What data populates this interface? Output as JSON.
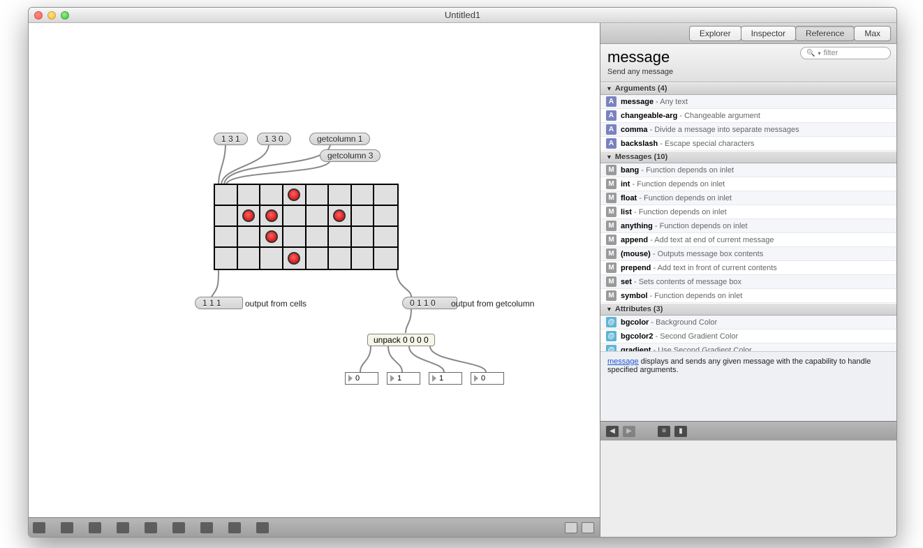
{
  "window": {
    "title": "Untitled1"
  },
  "patcher": {
    "messages": {
      "m131": "1 3 1",
      "m130": "1 3 0",
      "gc1": "getcolumn 1",
      "gc3": "getcolumn 3",
      "out_cells": "1 1 1",
      "out_col": "0 1 1 0"
    },
    "comments": {
      "cells": "output from cells",
      "col": "output from getcolumn"
    },
    "objects": {
      "unpack": "unpack 0 0 0 0"
    },
    "numbers": {
      "n1": "0",
      "n2": "1",
      "n3": "1",
      "n4": "0"
    }
  },
  "sidebar": {
    "tabs": [
      "Explorer",
      "Inspector",
      "Reference",
      "Max"
    ],
    "active_tab": "Reference",
    "object": "message",
    "subtitle": "Send any message",
    "search_placeholder": "filter",
    "sections": {
      "arguments": {
        "title": "Arguments (4)"
      },
      "messages_h": {
        "title": "Messages (10)"
      },
      "attributes": {
        "title": "Attributes (3)"
      }
    },
    "arguments": [
      {
        "name": "message",
        "desc": "Any text"
      },
      {
        "name": "changeable-arg",
        "desc": "Changeable argument"
      },
      {
        "name": "comma",
        "desc": "Divide a message into separate messages"
      },
      {
        "name": "backslash",
        "desc": "Escape special characters"
      }
    ],
    "messages": [
      {
        "name": "bang",
        "desc": "Function depends on inlet"
      },
      {
        "name": "int",
        "desc": "Function depends on inlet"
      },
      {
        "name": "float",
        "desc": "Function depends on inlet"
      },
      {
        "name": "list",
        "desc": "Function depends on inlet"
      },
      {
        "name": "anything",
        "desc": "Function depends on inlet"
      },
      {
        "name": "append",
        "desc": "Add text at end of current message"
      },
      {
        "name": "(mouse)",
        "desc": "Outputs message box contents"
      },
      {
        "name": "prepend",
        "desc": "Add text in front of current contents"
      },
      {
        "name": "set",
        "desc": "Sets contents of message box"
      },
      {
        "name": "symbol",
        "desc": "Function depends on inlet"
      }
    ],
    "attributes": [
      {
        "name": "bgcolor",
        "desc": "Background Color"
      },
      {
        "name": "bgcolor2",
        "desc": "Second Gradient Color"
      },
      {
        "name": "gradient",
        "desc": "Use Second Gradient Color"
      }
    ],
    "description_link": "message",
    "description_rest": " displays and sends any given message with the capability to handle specified arguments."
  }
}
